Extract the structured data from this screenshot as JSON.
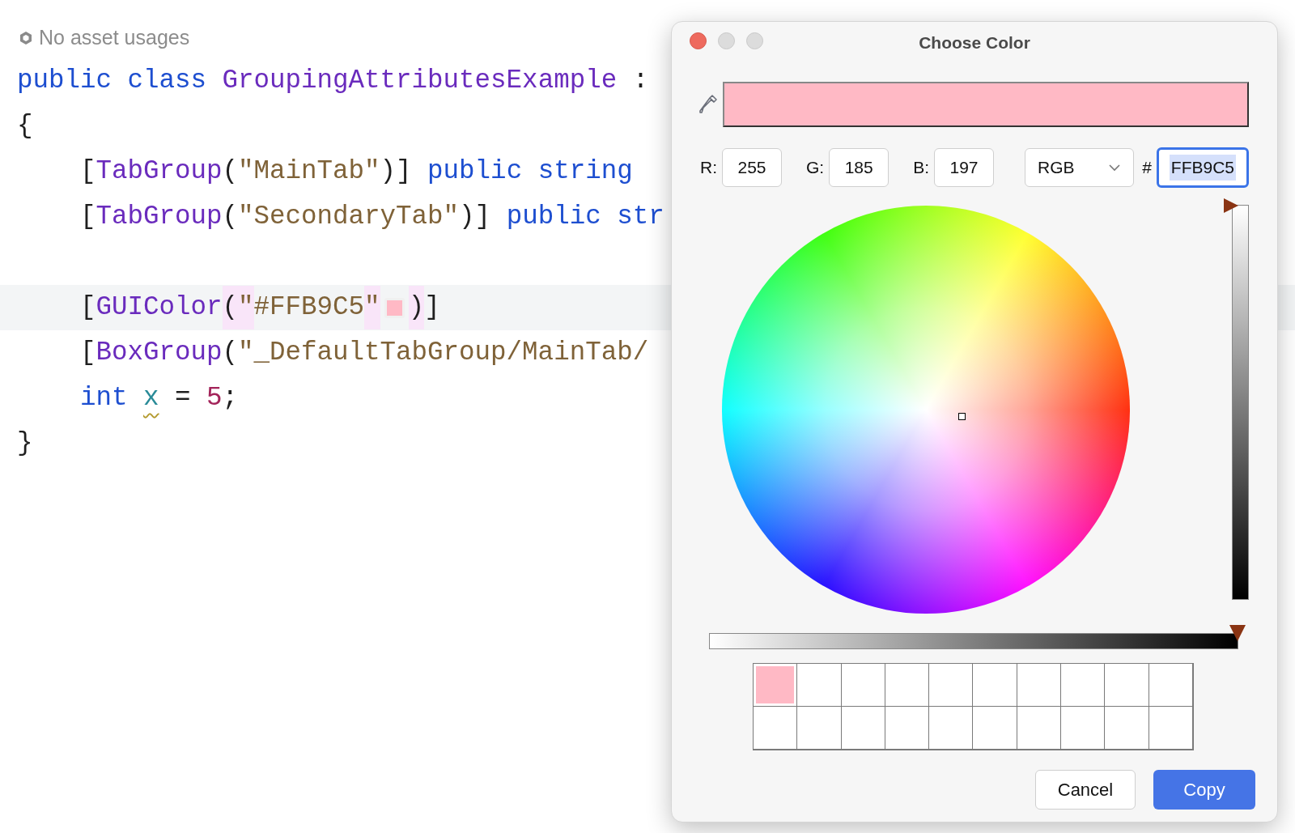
{
  "asset_usages": {
    "text": "No asset usages"
  },
  "code": [
    {
      "tokens": [
        {
          "text": "public ",
          "kind": "keyword"
        },
        {
          "text": "class ",
          "kind": "keyword"
        },
        {
          "text": "GroupingAttributesExample",
          "kind": "type"
        },
        {
          "text": " :",
          "kind": "punct"
        }
      ]
    },
    {
      "tokens": [
        {
          "text": "{",
          "kind": "punct"
        }
      ],
      "children": [
        {
          "tokens": [
            {
              "text": "[",
              "kind": "punct"
            },
            {
              "text": "TabGroup",
              "kind": "type"
            },
            {
              "text": "(",
              "kind": "punct"
            },
            {
              "text": "\"MainTab\"",
              "kind": "string"
            },
            {
              "text": ")] ",
              "kind": "punct"
            },
            {
              "text": "public ",
              "kind": "keyword"
            },
            {
              "text": "string",
              "kind": "keyword"
            }
          ]
        },
        {
          "tokens": [
            {
              "text": "[",
              "kind": "punct"
            },
            {
              "text": "TabGroup",
              "kind": "type"
            },
            {
              "text": "(",
              "kind": "punct"
            },
            {
              "text": "\"SecondaryTab\"",
              "kind": "string"
            },
            {
              "text": ")] ",
              "kind": "punct"
            },
            {
              "text": "public ",
              "kind": "keyword"
            },
            {
              "text": "str",
              "kind": "keyword"
            }
          ]
        },
        {
          "gap_before": true,
          "current": true,
          "tokens": [
            {
              "text": "[",
              "kind": "punct"
            },
            {
              "text": "GUIColor",
              "kind": "type"
            },
            {
              "text": "(",
              "kind": "punct",
              "matched": true
            },
            {
              "text": "\"",
              "kind": "string",
              "matched": true
            },
            {
              "text": "#FFB9C5",
              "kind": "string"
            },
            {
              "text": "\"",
              "kind": "string",
              "matched": true
            },
            {
              "kind": "swatch",
              "color": "#ffb9c5"
            },
            {
              "text": ")",
              "kind": "punct",
              "matched": true
            },
            {
              "text": "]",
              "kind": "punct"
            }
          ]
        },
        {
          "tokens": [
            {
              "text": "[",
              "kind": "punct"
            },
            {
              "text": "BoxGroup",
              "kind": "type"
            },
            {
              "text": "(",
              "kind": "punct"
            },
            {
              "text": "\"_DefaultTabGroup/MainTab/",
              "kind": "string"
            }
          ]
        },
        {
          "tokens": [
            {
              "text": "int ",
              "kind": "keyword"
            },
            {
              "text": "x",
              "kind": "field",
              "warning": true
            },
            {
              "text": " = ",
              "kind": "punct"
            },
            {
              "text": "5",
              "kind": "number"
            },
            {
              "text": ";",
              "kind": "punct"
            }
          ]
        }
      ]
    },
    {
      "tokens": [
        {
          "text": "}",
          "kind": "punct"
        }
      ]
    }
  ],
  "dialog": {
    "title": "Choose Color",
    "preview": {
      "color": "#ffb9c5"
    },
    "channels": [
      {
        "label": "R:",
        "value": "255"
      },
      {
        "label": "G:",
        "value": "185"
      },
      {
        "label": "B:",
        "value": "197"
      }
    ],
    "mode": {
      "value": "RGB"
    },
    "hex": {
      "prefix": "#",
      "value": "FFB9C5",
      "text_selected": true,
      "focused": true
    },
    "brightness": {
      "level": 1
    },
    "opacity": {
      "level": 1
    },
    "recent_colors": [
      {
        "color": "#ffb9c5"
      }
    ],
    "buttons": [
      {
        "label": "Cancel",
        "primary": false
      },
      {
        "label": "Copy",
        "primary": true
      }
    ]
  }
}
